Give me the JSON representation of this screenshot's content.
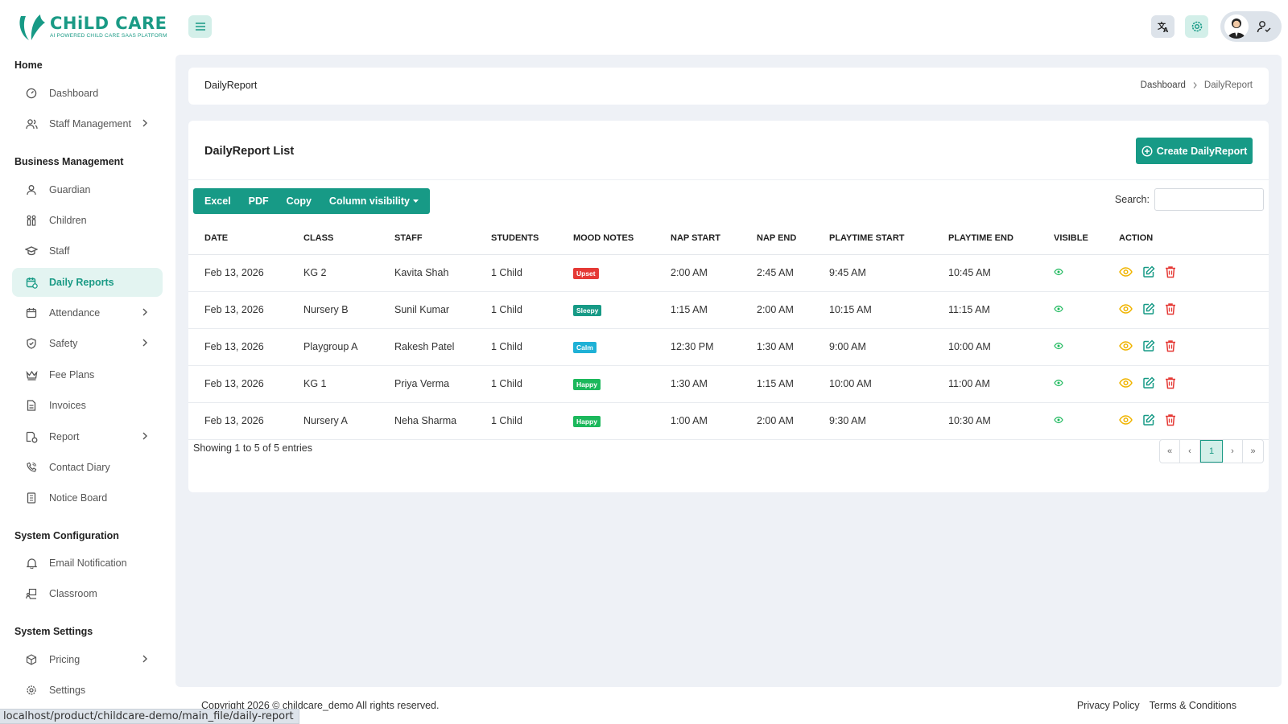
{
  "brand": {
    "name": "CHiLD CARE",
    "tagline": "AI POWERED CHILD CARE SAAS PLATFORM",
    "accent": "#179a86"
  },
  "sidebar": {
    "sections": [
      {
        "title": "Home"
      },
      {
        "title": "Business Management"
      },
      {
        "title": "System Configuration"
      },
      {
        "title": "System Settings"
      }
    ],
    "items": [
      {
        "label": "Dashboard",
        "icon": "dashboard-icon"
      },
      {
        "label": "Staff Management",
        "icon": "users-icon",
        "has_children": true
      },
      {
        "label": "Guardian",
        "icon": "user-icon"
      },
      {
        "label": "Children",
        "icon": "children-icon"
      },
      {
        "label": "Staff",
        "icon": "graduation-cap-icon"
      },
      {
        "label": "Daily Reports",
        "icon": "calendar-report-icon",
        "active": true
      },
      {
        "label": "Attendance",
        "icon": "calendar-icon",
        "has_children": true
      },
      {
        "label": "Safety",
        "icon": "shield-icon",
        "has_children": true
      },
      {
        "label": "Fee Plans",
        "icon": "crown-icon"
      },
      {
        "label": "Invoices",
        "icon": "document-icon"
      },
      {
        "label": "Report",
        "icon": "report-icon",
        "has_children": true
      },
      {
        "label": "Contact Diary",
        "icon": "phone-icon"
      },
      {
        "label": "Notice Board",
        "icon": "notice-icon"
      },
      {
        "label": "Email Notification",
        "icon": "bell-icon"
      },
      {
        "label": "Classroom",
        "icon": "classroom-icon"
      },
      {
        "label": "Pricing",
        "icon": "box-icon",
        "has_children": true
      },
      {
        "label": "Settings",
        "icon": "gear-icon"
      }
    ]
  },
  "breadcrumb": {
    "title": "DailyReport",
    "home": "Dashboard",
    "current": "DailyReport"
  },
  "list": {
    "title": "DailyReport List",
    "create_label": "Create DailyReport",
    "export_buttons": [
      "Excel",
      "PDF",
      "Copy",
      "Column visibility"
    ],
    "search_label": "Search:",
    "search_value": "",
    "columns": [
      "DATE",
      "CLASS",
      "STAFF",
      "STUDENTS",
      "MOOD NOTES",
      "NAP START",
      "NAP END",
      "PLAYTIME START",
      "PLAYTIME END",
      "VISIBLE",
      "ACTION"
    ],
    "rows": [
      {
        "date": "Feb 13, 2026",
        "class": "KG 2",
        "staff": "Kavita Shah",
        "students": "1 Child",
        "mood": "Upset",
        "mood_color": "#e53935",
        "nap_start": "2:00 AM",
        "nap_end": "2:45 AM",
        "play_start": "9:45 AM",
        "play_end": "10:45 AM"
      },
      {
        "date": "Feb 13, 2026",
        "class": "Nursery B",
        "staff": "Sunil Kumar",
        "students": "1 Child",
        "mood": "Sleepy",
        "mood_color": "#179a86",
        "nap_start": "1:15 AM",
        "nap_end": "2:00 AM",
        "play_start": "10:15 AM",
        "play_end": "11:15 AM"
      },
      {
        "date": "Feb 13, 2026",
        "class": "Playgroup A",
        "staff": "Rakesh Patel",
        "students": "1 Child",
        "mood": "Calm",
        "mood_color": "#1fb1d6",
        "nap_start": "12:30 PM",
        "nap_end": "1:30 AM",
        "play_start": "9:00 AM",
        "play_end": "10:00 AM"
      },
      {
        "date": "Feb 13, 2026",
        "class": "KG 1",
        "staff": "Priya Verma",
        "students": "1 Child",
        "mood": "Happy",
        "mood_color": "#1cb85c",
        "nap_start": "1:30 AM",
        "nap_end": "1:15 AM",
        "play_start": "10:00 AM",
        "play_end": "11:00 AM"
      },
      {
        "date": "Feb 13, 2026",
        "class": "Nursery A",
        "staff": "Neha Sharma",
        "students": "1 Child",
        "mood": "Happy",
        "mood_color": "#1cb85c",
        "nap_start": "1:00 AM",
        "nap_end": "2:00 AM",
        "play_start": "9:30 AM",
        "play_end": "10:30 AM"
      }
    ],
    "showing": "Showing 1 to 5 of 5 entries",
    "pager": {
      "first": "«",
      "prev": "‹",
      "current": "1",
      "next": "›",
      "last": "»"
    }
  },
  "footer": {
    "copyright": "Copyright 2026 © childcare_demo All rights reserved.",
    "privacy": "Privacy Policy",
    "terms": "Terms & Conditions"
  },
  "status_url": "localhost/product/childcare-demo/main_file/daily-report"
}
